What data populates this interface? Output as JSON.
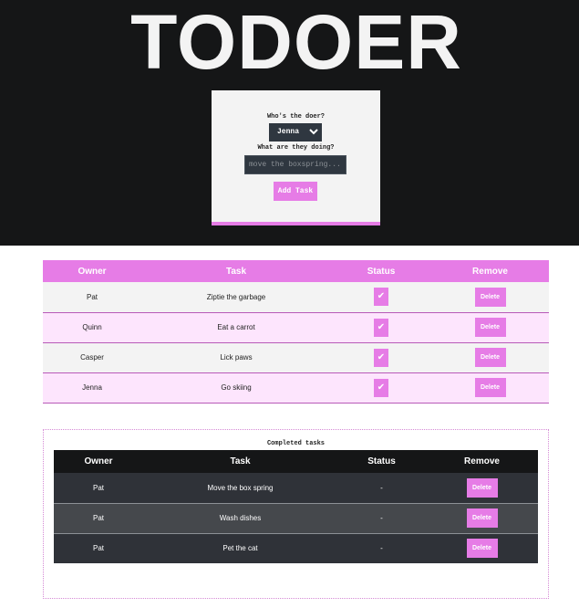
{
  "app": {
    "title": "TODOER"
  },
  "form": {
    "doer_label": "Who's the doer?",
    "doer_value": "Jenna",
    "task_label": "What are they doing?",
    "task_placeholder": "move the boxspring...",
    "add_button": "Add Task"
  },
  "active_table": {
    "headers": {
      "owner": "Owner",
      "task": "Task",
      "status": "Status",
      "remove": "Remove"
    },
    "rows": [
      {
        "owner": "Pat",
        "task": "Ziptie the garbage",
        "status": "✔",
        "remove": "Delete"
      },
      {
        "owner": "Quinn",
        "task": "Eat a carrot",
        "status": "✔",
        "remove": "Delete"
      },
      {
        "owner": "Casper",
        "task": "Lick paws",
        "status": "✔",
        "remove": "Delete"
      },
      {
        "owner": "Jenna",
        "task": "Go skiing",
        "status": "✔",
        "remove": "Delete"
      }
    ]
  },
  "completed": {
    "caption": "Completed tasks",
    "headers": {
      "owner": "Owner",
      "task": "Task",
      "status": "Status",
      "remove": "Remove"
    },
    "rows": [
      {
        "owner": "Pat",
        "task": "Move the box spring",
        "status": "-",
        "remove": "Delete"
      },
      {
        "owner": "Pat",
        "task": "Wash dishes",
        "status": "-",
        "remove": "Delete"
      },
      {
        "owner": "Pat",
        "task": "Pet the cat",
        "status": "-",
        "remove": "Delete"
      }
    ]
  },
  "icons": {
    "select_arrow": "chevron-down-icon",
    "status_done": "checkmark-icon"
  },
  "colors": {
    "accent": "#e67ce6",
    "dark": "#151617",
    "row_dark": "#2f3238",
    "row_alt": "#45484c",
    "row_light": "#f3f3f3",
    "row_pink": "#fde5fd"
  }
}
